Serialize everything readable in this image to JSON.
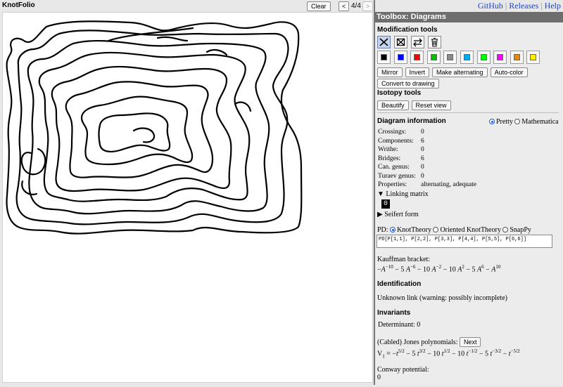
{
  "app": {
    "title": "KnotFolio"
  },
  "topbar": {
    "clear_label": "Clear",
    "prev_label": "<",
    "page_counter": "4/4",
    "next_label": ">"
  },
  "links": {
    "github": "GitHub",
    "releases": "Releases",
    "help": "Help",
    "sep": "|"
  },
  "toolbox": {
    "header": "Toolbox: Diagrams",
    "modification_title": "Modification tools",
    "tools": [
      "crossing-tool-icon",
      "erase-crossing-icon",
      "swap-icon",
      "trash-icon"
    ],
    "colors": [
      "#000000",
      "#0000ff",
      "#ff0000",
      "#00c000",
      "#8a8a8a",
      "#00aaee",
      "#00ff00",
      "#ff00ff",
      "#ee8800",
      "#ffee00"
    ],
    "actions": [
      "Mirror",
      "Invert",
      "Make alternating",
      "Auto-color"
    ],
    "convert_label": "Convert to drawing",
    "isotopy_title": "Isotopy tools",
    "beautify_label": "Beautify",
    "reset_view_label": "Reset view"
  },
  "diagram_info": {
    "title": "Diagram information",
    "mode_pretty": "Pretty",
    "mode_mathematica": "Mathematica",
    "rows": [
      {
        "k": "Crossings:",
        "v": "0"
      },
      {
        "k": "Components:",
        "v": "6"
      },
      {
        "k": "Writhe:",
        "v": "0"
      },
      {
        "k": "Bridges:",
        "v": "6"
      },
      {
        "k": "Can. genus:",
        "v": "0"
      },
      {
        "k": "Turaev genus:",
        "v": "0"
      },
      {
        "k": "Properties:",
        "v": "alternating, adequate"
      }
    ],
    "linking_matrix_label": "Linking matrix",
    "linking_matrix_value": "0",
    "seifert_label": "Seifert form",
    "pd_label": "PD:",
    "pd_opt1": "KnotTheory",
    "pd_opt2": "Oriented KnotTheory",
    "pd_opt3": "SnapPy",
    "pd_value": "PD[P[1,1], P[2,2], P[3,3], P[4,4], P[5,5], P[6,6]]",
    "kauffman_label": "Kauffman bracket:"
  },
  "identification": {
    "title": "Identification",
    "text": "Unknown link (warning: possibly incomplete)"
  },
  "invariants": {
    "title": "Invariants",
    "determinant_label": "Determinant:",
    "determinant_value": "0",
    "jones_label": "(Cabled) Jones polynomials:",
    "next_label": "Next",
    "conway_label": "Conway potential:",
    "conway_value": "0"
  }
}
